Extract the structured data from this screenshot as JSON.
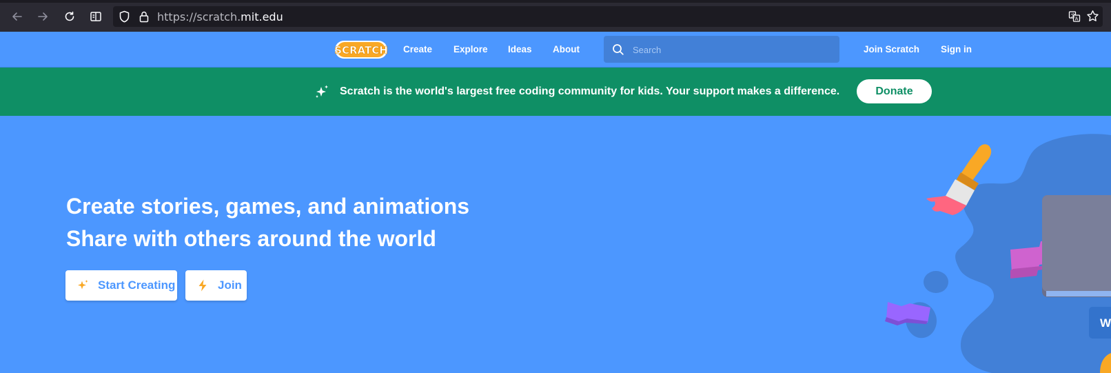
{
  "browser": {
    "url_prefix": "https://scratch.",
    "url_domain": "mit.edu",
    "icons": [
      "back-arrow-icon",
      "forward-arrow-icon",
      "reload-icon",
      "reader-view-icon",
      "shield-icon",
      "lock-icon",
      "translate-icon",
      "star-bookmark-icon"
    ]
  },
  "header": {
    "logo_text": "SCRATCH",
    "nav": [
      "Create",
      "Explore",
      "Ideas",
      "About"
    ],
    "search_placeholder": "Search",
    "join_label": "Join Scratch",
    "signin_label": "Sign in"
  },
  "banner": {
    "message": "Scratch is the world's largest free coding community for kids. Your support makes a difference.",
    "donate_label": "Donate"
  },
  "hero": {
    "line1": "Create stories, games, and animations",
    "line2": "Share with others around the world",
    "start_label": "Start Creating",
    "join_label": "Join",
    "cutoff_button_text": "W"
  },
  "colors": {
    "brand_blue": "#4c97ff",
    "banner_green": "#0f8f65",
    "browser_dark": "#2b2a33",
    "logo_orange": "#f9a825"
  }
}
